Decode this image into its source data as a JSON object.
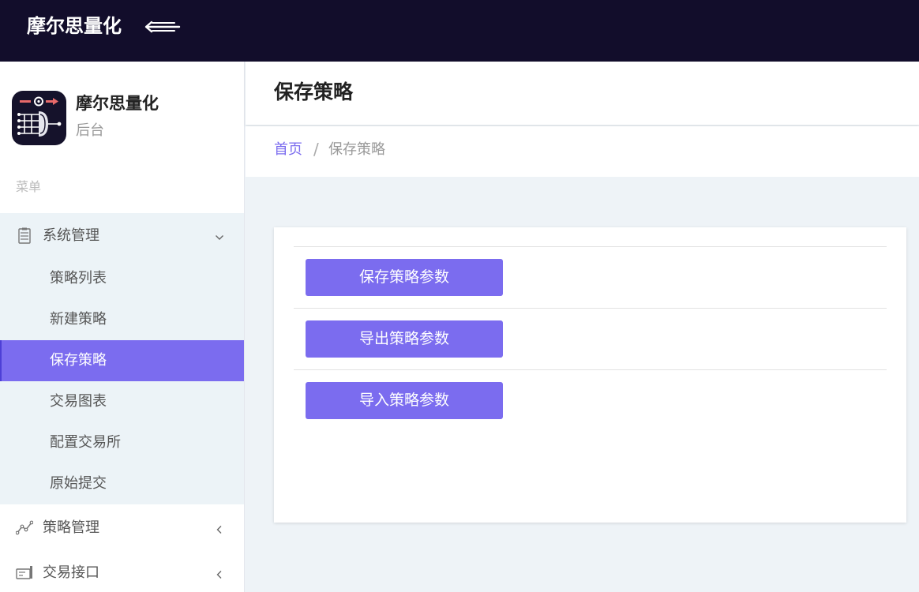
{
  "header": {
    "brand": "摩尔思量化"
  },
  "sidebar": {
    "profile": {
      "name": "摩尔思量化",
      "subtitle": "后台"
    },
    "caption": "菜单",
    "groups": [
      {
        "label": "系统管理",
        "expanded": true,
        "items": [
          {
            "label": "策略列表"
          },
          {
            "label": "新建策略"
          },
          {
            "label": "保存策略",
            "active": true
          },
          {
            "label": "交易图表"
          },
          {
            "label": "配置交易所"
          },
          {
            "label": "原始提交"
          }
        ]
      },
      {
        "label": "策略管理",
        "expanded": false
      },
      {
        "label": "交易接口",
        "expanded": false
      }
    ]
  },
  "page": {
    "title": "保存策略"
  },
  "breadcrumb": {
    "home": "首页",
    "separator": "/",
    "current": "保存策略"
  },
  "actions": [
    {
      "label": "保存策略参数"
    },
    {
      "label": "导出策略参数"
    },
    {
      "label": "导入策略参数"
    }
  ],
  "colors": {
    "topbar": "#120d2b",
    "accent": "#7b6cef",
    "content_bg": "#eef3f7",
    "submenu_bg": "#ecf3f7"
  },
  "icons": {
    "menu_toggle": "arrow-left-lines-icon",
    "group_system": "server-icon",
    "group_strategy": "line-chart-icon",
    "group_trading": "card-reader-icon"
  }
}
